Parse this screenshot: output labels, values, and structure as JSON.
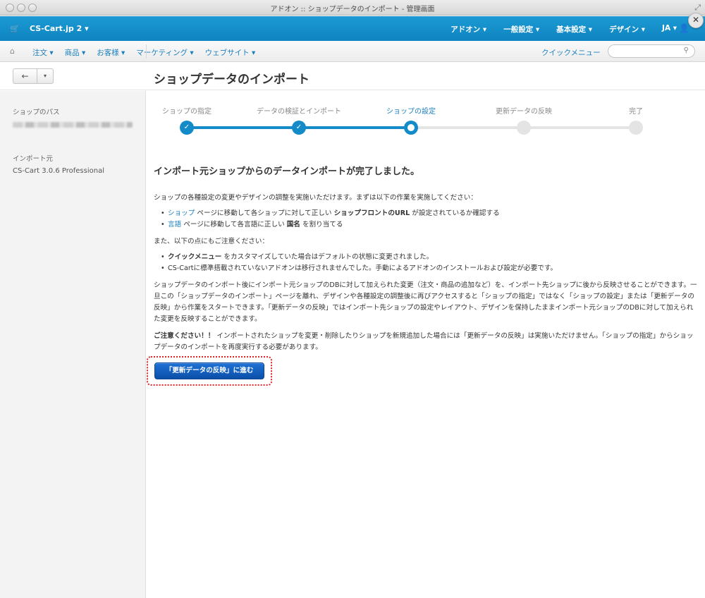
{
  "window": {
    "title": "アドオン :: ショップデータのインポート - 管理画面"
  },
  "topnav": {
    "store": "CS-Cart.jp 2 ▾",
    "menu": [
      "アドオン ▾",
      "一般設定 ▾",
      "基本設定 ▾",
      "デザイン ▾",
      "JA ▾"
    ]
  },
  "subnav": {
    "items": [
      "注文 ▾",
      "商品 ▾",
      "お客様 ▾",
      "マーケティング ▾",
      "ウェブサイト ▾"
    ],
    "quick_menu": "クイックメニュー",
    "search_placeholder": ""
  },
  "toolbar": {
    "back": "←",
    "dropdown": "▾",
    "page_title": "ショップデータのインポート"
  },
  "sidebar": {
    "shop_path_label": "ショップのパス",
    "import_source_label": "インポート元",
    "import_source_value": "CS-Cart 3.0.6 Professional"
  },
  "steps": [
    {
      "label": "ショップの指定",
      "state": "done"
    },
    {
      "label": "データの検証とインポート",
      "state": "done"
    },
    {
      "label": "ショップの設定",
      "state": "current"
    },
    {
      "label": "更新データの反映",
      "state": "todo"
    },
    {
      "label": "完了",
      "state": "todo"
    }
  ],
  "content": {
    "headline": "インポート元ショップからのデータインポートが完了しました。",
    "intro": "ショップの各種設定の変更やデザインの調整を実施いただけます。まずは以下の作業を実施してください：",
    "tasks": [
      {
        "link": "ショップ",
        "text1": " ページに移動して各ショップに対して正しい ",
        "bold": "ショップフロントのURL",
        "text2": " が設定されているか確認する"
      },
      {
        "link": "言語",
        "text1": " ページに移動して各言語に正しい ",
        "bold": "国名",
        "text2": " を割り当てる"
      }
    ],
    "notes_intro": "また、以下の点にもご注意ください：",
    "note1_bold": "クイックメニュー",
    "note1_text": " をカスタマイズしていた場合はデフォルトの状態に変更されました。",
    "note2_red": "CS-Cartに標準搭載されていないアドオンは移行されませんでした。",
    "note2_text": "手動によるアドオンのインストールおよび設定が必要です。",
    "paragraph": "ショップデータのインポート後にインポート元ショップのDBに対して加えられた変更（注文・商品の追加など）を、インポート先ショップに後から反映させることができます。一旦この「ショップデータのインポート」ページを離れ、デザインや各種設定の調整後に再びアクセスすると「ショップの指定」ではなく「ショップの設定」または「更新データの反映」から作業をスタートできます。「更新データの反映」ではインポート先ショップの設定やレイアウト、デザインを保持したままインポート元ショップのDBに対して加えられた変更を反映することができます。",
    "warning_bold": "ご注意ください！！",
    "warning_text": " インポートされたショップを変更・削除したりショップを新規追加した場合には「更新データの反映」は実施いただけません。「ショップの指定」からショップデータのインポートを再度実行する必要があります。",
    "cta": "「更新データの反映」に進む"
  },
  "colors": {
    "nav_blue": "#1b9ad3",
    "step_blue": "#138bc8",
    "cta_blue": "#1f72d6",
    "highlight_red": "#d9262b"
  }
}
